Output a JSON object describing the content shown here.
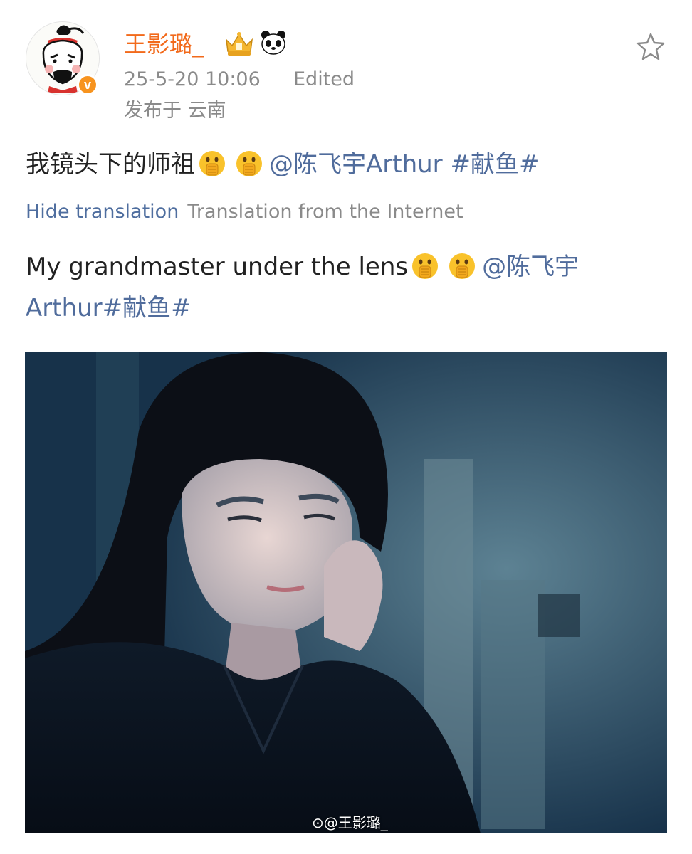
{
  "post": {
    "author": {
      "name": "王影璐_",
      "avatar_icon": "cartoon-face-avatar",
      "verified_icon": "verified-badge-icon",
      "verified_mark": "v",
      "badges": [
        "crown-badge-icon",
        "panda-badge-icon"
      ],
      "name_color": "#f26a1b"
    },
    "timestamp": "25-5-20 10:06",
    "edited_label": "Edited",
    "location": "发布于 云南",
    "text": {
      "main": "我镜头下的师祖",
      "mention": "@陈飞宇Arthur",
      "hashtag": "#献鱼#",
      "emoji": "shushing-face-emoji"
    },
    "translation": {
      "hide_label": "Hide translation",
      "source_label": "Translation from the Internet",
      "text": "My grandmaster under the lens",
      "mention_part1": "@陈飞宇",
      "mention_part2": "Arthur",
      "hashtag": "#献鱼#"
    },
    "photo": {
      "description_icon": "portrait-photo",
      "watermark": "@王影璐_"
    },
    "favorite_icon": "star-icon"
  },
  "colors": {
    "link": "#506c9c",
    "meta": "#8a8a8a",
    "accent_orange": "#f26a1b"
  }
}
